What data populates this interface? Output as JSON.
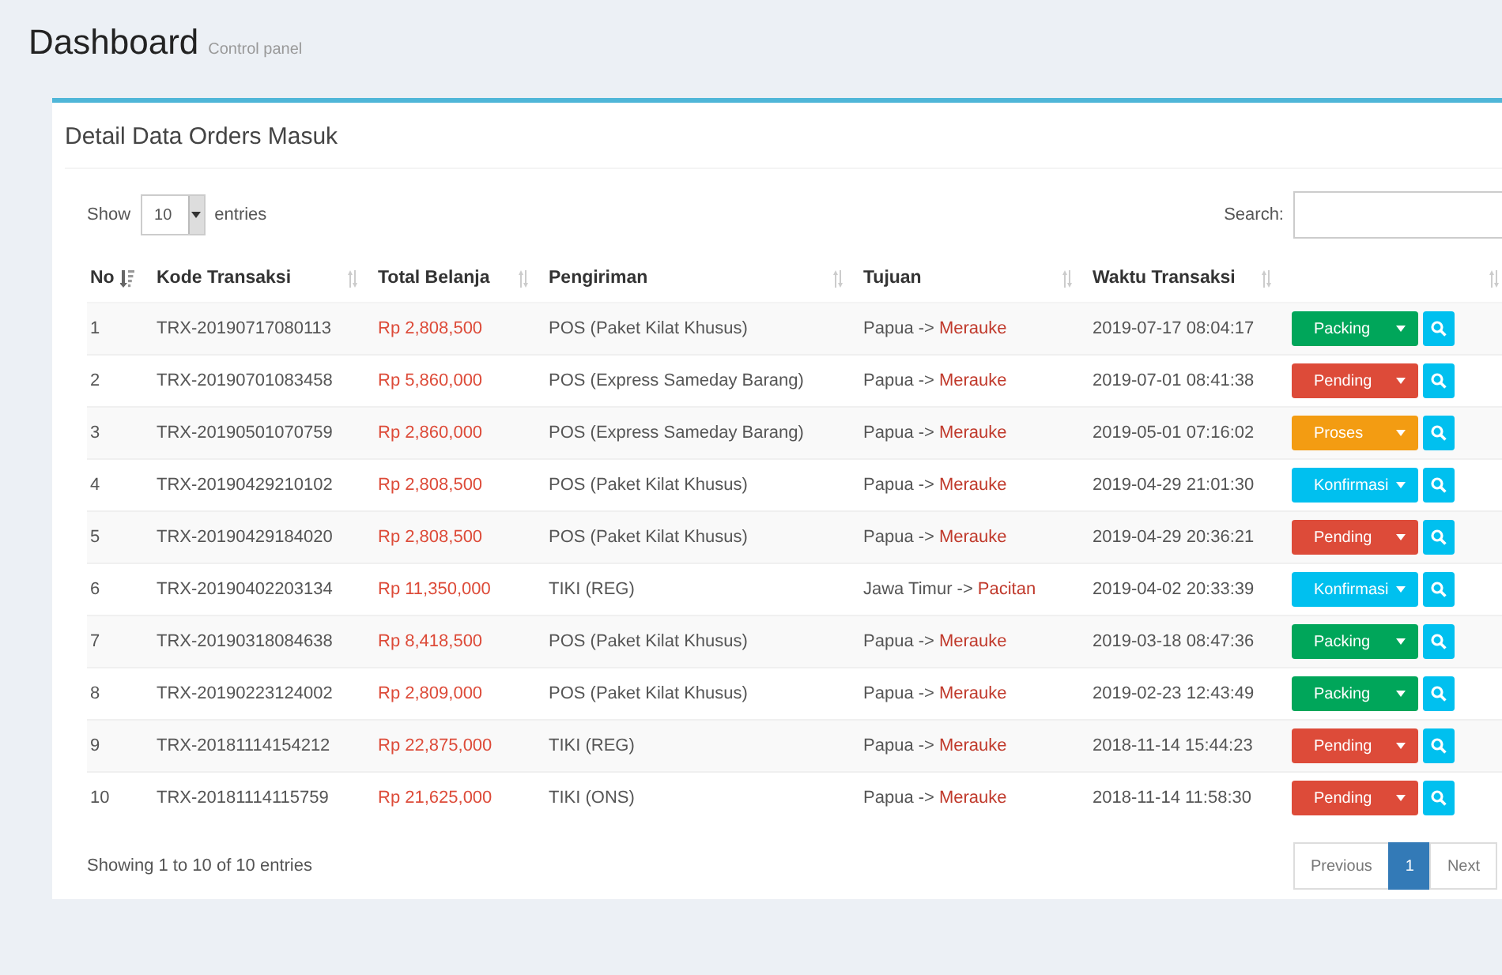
{
  "header": {
    "title": "Dashboard",
    "subtitle": "Control panel"
  },
  "box": {
    "title": "Detail Data Orders Masuk"
  },
  "length_control": {
    "before": "Show",
    "value": "10",
    "after": "entries"
  },
  "search": {
    "label": "Search:"
  },
  "table": {
    "columns": [
      {
        "label": "No",
        "sorted": true
      },
      {
        "label": "Kode Transaksi",
        "sorted": false
      },
      {
        "label": "Total Belanja",
        "sorted": false
      },
      {
        "label": "Pengiriman",
        "sorted": false
      },
      {
        "label": "Tujuan",
        "sorted": false
      },
      {
        "label": "Waktu Transaksi",
        "sorted": false
      },
      {
        "sorted": false
      }
    ],
    "rows": [
      {
        "no": "1",
        "kode": "TRX-20190717080113",
        "total": "Rp 2,808,500",
        "pengiriman": "POS (Paket Kilat Khusus)",
        "origin": "Papua ->",
        "city": "Merauke",
        "waktu": "2019-07-17 08:04:17",
        "status": {
          "label": "Packing",
          "color": "#00a65a"
        }
      },
      {
        "no": "2",
        "kode": "TRX-20190701083458",
        "total": "Rp 5,860,000",
        "pengiriman": "POS (Express Sameday Barang)",
        "origin": "Papua ->",
        "city": "Merauke",
        "waktu": "2019-07-01 08:41:38",
        "status": {
          "label": "Pending",
          "color": "#dd4b39"
        }
      },
      {
        "no": "3",
        "kode": "TRX-20190501070759",
        "total": "Rp 2,860,000",
        "pengiriman": "POS (Express Sameday Barang)",
        "origin": "Papua ->",
        "city": "Merauke",
        "waktu": "2019-05-01 07:16:02",
        "status": {
          "label": "Proses",
          "color": "#f39c12"
        }
      },
      {
        "no": "4",
        "kode": "TRX-20190429210102",
        "total": "Rp 2,808,500",
        "pengiriman": "POS (Paket Kilat Khusus)",
        "origin": "Papua ->",
        "city": "Merauke",
        "waktu": "2019-04-29 21:01:30",
        "status": {
          "label": "Konfirmasi",
          "color": "#00c0ef"
        }
      },
      {
        "no": "5",
        "kode": "TRX-20190429184020",
        "total": "Rp 2,808,500",
        "pengiriman": "POS (Paket Kilat Khusus)",
        "origin": "Papua ->",
        "city": "Merauke",
        "waktu": "2019-04-29 20:36:21",
        "status": {
          "label": "Pending",
          "color": "#dd4b39"
        }
      },
      {
        "no": "6",
        "kode": "TRX-20190402203134",
        "total": "Rp 11,350,000",
        "pengiriman": "TIKI (REG)",
        "origin": "Jawa Timur ->",
        "city": "Pacitan",
        "waktu": "2019-04-02 20:33:39",
        "status": {
          "label": "Konfirmasi",
          "color": "#00c0ef"
        }
      },
      {
        "no": "7",
        "kode": "TRX-20190318084638",
        "total": "Rp 8,418,500",
        "pengiriman": "POS (Paket Kilat Khusus)",
        "origin": "Papua ->",
        "city": "Merauke",
        "waktu": "2019-03-18 08:47:36",
        "status": {
          "label": "Packing",
          "color": "#00a65a"
        }
      },
      {
        "no": "8",
        "kode": "TRX-20190223124002",
        "total": "Rp 2,809,000",
        "pengiriman": "POS (Paket Kilat Khusus)",
        "origin": "Papua ->",
        "city": "Merauke",
        "waktu": "2019-02-23 12:43:49",
        "status": {
          "label": "Packing",
          "color": "#00a65a"
        }
      },
      {
        "no": "9",
        "kode": "TRX-20181114154212",
        "total": "Rp 22,875,000",
        "pengiriman": "TIKI (REG)",
        "origin": "Papua ->",
        "city": "Merauke",
        "waktu": "2018-11-14 15:44:23",
        "status": {
          "label": "Pending",
          "color": "#dd4b39"
        }
      },
      {
        "no": "10",
        "kode": "TRX-20181114115759",
        "total": "Rp 21,625,000",
        "pengiriman": "TIKI (ONS)",
        "origin": "Papua ->",
        "city": "Merauke",
        "waktu": "2018-11-14 11:58:30",
        "status": {
          "label": "Pending",
          "color": "#dd4b39"
        }
      }
    ]
  },
  "info": "Showing 1 to 10 of 10 entries",
  "pagination": [
    {
      "label": "Previous",
      "selected": false
    },
    {
      "label": "1",
      "selected": true
    },
    {
      "label": "Next",
      "selected": false
    }
  ]
}
